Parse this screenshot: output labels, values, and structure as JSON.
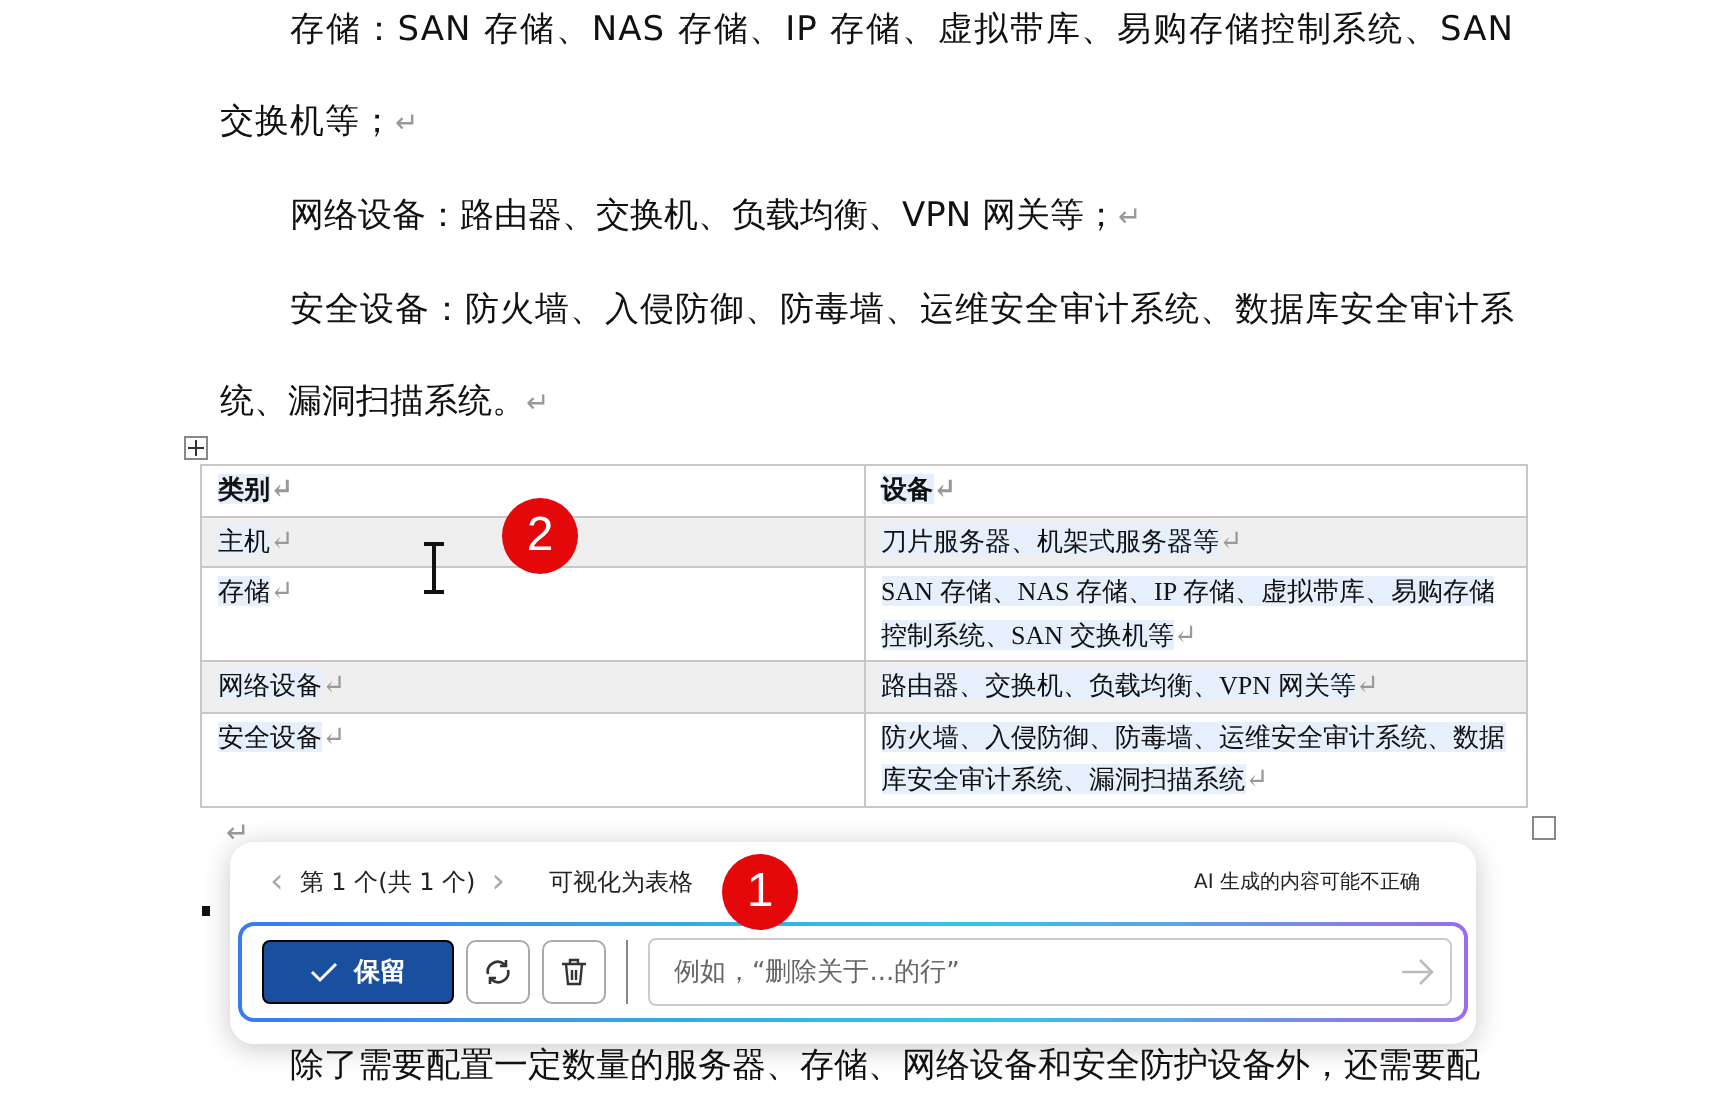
{
  "paragraphs": [
    {
      "text": "存储：SAN 存储、NAS 存储、IP 存储、虚拟带库、易购存储控制系统、SAN 交换机等；",
      "end_mark": "↵"
    },
    {
      "text": "网络设备：路由器、交换机、负载均衡、VPN 网关等；",
      "end_mark": "↵"
    },
    {
      "text": "安全设备：防火墙、入侵防御、防毒墙、运维安全审计系统、数据库安全审计系统、漏洞扫描系统。",
      "end_mark": "↵"
    }
  ],
  "table": {
    "columns": [
      {
        "label": "类别",
        "end_mark": "↵"
      },
      {
        "label": "设备",
        "end_mark": "↵"
      }
    ],
    "rows": [
      {
        "shaded": true,
        "cells": [
          {
            "text": "主机",
            "end_mark": "↵"
          },
          {
            "text": "刀片服务器、机架式服务器等",
            "end_mark": "↵"
          }
        ]
      },
      {
        "shaded": false,
        "cells": [
          {
            "text": "存储",
            "end_mark": "↵"
          },
          {
            "text": "SAN 存储、NAS 存储、IP 存储、虚拟带库、易购存储控制系统、SAN 交换机等",
            "end_mark": "↵"
          }
        ]
      },
      {
        "shaded": true,
        "cells": [
          {
            "text": "网络设备",
            "end_mark": "↵"
          },
          {
            "text": "路由器、交换机、负载均衡、VPN 网关等",
            "end_mark": "↵"
          }
        ]
      },
      {
        "shaded": false,
        "cells": [
          {
            "text": "安全设备",
            "end_mark": "↵"
          },
          {
            "text": "防火墙、入侵防御、防毒墙、运维安全审计系统、数据库安全审计系统、漏洞扫描系统",
            "end_mark": "↵"
          }
        ]
      }
    ]
  },
  "after_table_mark": "↵",
  "ai_popup": {
    "prev": "‹",
    "counter": "第 1 个(共 1 个)",
    "next": "›",
    "action": "可视化为表格",
    "disclaimer": "AI 生成的内容可能不正确",
    "keep_button": "保留",
    "prompt": {
      "placeholder": "例如，“删除关于...的行”"
    }
  },
  "last_paragraph": "除了需要配置一定数量的服务器、存储、网络设备和安全防护设备外，还需要配",
  "markers": [
    {
      "label": "1"
    },
    {
      "label": "2"
    }
  ]
}
